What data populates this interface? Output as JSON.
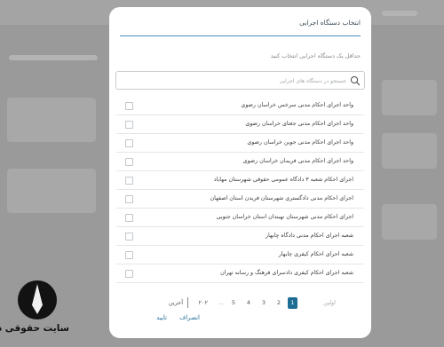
{
  "modal": {
    "title": "انتخاب دستگاه اجرایی",
    "hint": "حداقل یک دستگاه اجرایی انتخاب کنید",
    "search_placeholder": "جستجو در دستگاه های اجرایی"
  },
  "items": [
    "واحد اجرای احکام مدنی سرخس خراسان رضوی",
    "واحد اجرای احکام مدنی جغتای خراسان رضوی",
    "واحد اجرای احکام مدنی جوین خراسان رضوی",
    "واحد اجرای احکام مدنی فریمان خراسان رضوی",
    "اجرای احکام شعبه ۳ دادگاه عمومی حقوقی شهرستان مهاباد",
    "اجرای احکام مدنی دادگستری شهرستان فریدن استان اصفهان",
    "اجرای احکام مدنی شهرستان نهبندان استان خراسان جنوبی",
    "شعبه اجرای احکام مدنی دادگاه چابهار",
    "شعبه اجرای احکام کیفری چابهار",
    "شعبه اجرای احکام کیفری دادسرای فرهنگ و رسانه تهران"
  ],
  "pagination": {
    "first": "اولین",
    "pages": [
      "1",
      "2",
      "3",
      "4",
      "5"
    ],
    "ellipsis": "...",
    "last_page": "۲۰۲",
    "last": "آخرین",
    "active": "1"
  },
  "buttons": {
    "cancel": "انصراف",
    "confirm": "تایید"
  },
  "watermark": {
    "text": "سایت حقوقی دینا"
  },
  "colors": {
    "accent": "#1e6d95",
    "overlay": "#8e8e8e"
  }
}
